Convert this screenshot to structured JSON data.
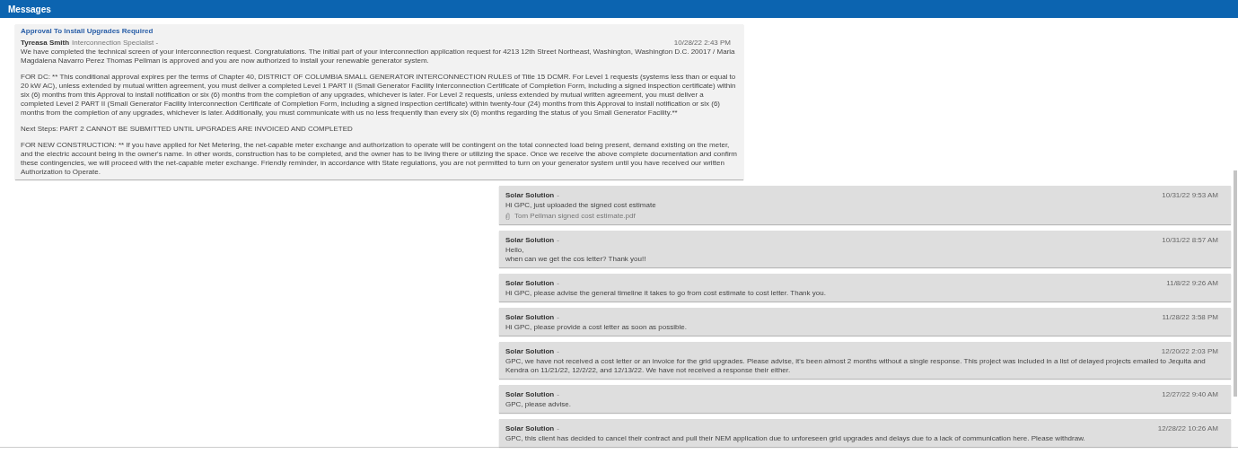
{
  "header": {
    "title": "Messages"
  },
  "messages": [
    {
      "kind": "notice",
      "subject": "Approval To Install Upgrades Required",
      "sender": "Tyreasa Smith",
      "role": "Interconnection Specialist -",
      "time": "10/28/22 2:43 PM",
      "paragraphs": [
        "We have completed the technical screen of your interconnection request. Congratulations. The initial part of your interconnection application request for 4213 12th Street Northeast, Washington, Washington D.C. 20017 / Maria Magdalena Navarro Perez Thomas Pellman is approved and you are now authorized to install your renewable generator system.",
        "FOR DC: ** This conditional approval expires per the terms of Chapter 40, DISTRICT OF COLUMBIA SMALL GENERATOR INTERCONNECTION RULES of Title 15 DCMR. For Level 1 requests (systems less than or equal to 20 kW AC), unless extended by mutual written agreement, you must deliver a completed Level 1 PART II (Small Generator Facility Interconnection Certificate of Completion Form, including a signed inspection certificate) within six (6) months from this Approval to install notification or six (6) months from the completion of any upgrades, whichever is later. For Level 2 requests, unless extended by mutual written agreement, you must deliver a completed Level 2 PART II (Small Generator Facility Interconnection Certificate of Completion Form, including a signed inspection certificate) within twenty-four (24) months from this Approval to install notification or six (6) months from the completion of any upgrades, whichever is later. Additionally, you must communicate with us no less frequently than every six (6) months regarding the status of you Small Generator Facility.**",
        "Next Steps: PART 2 CANNOT BE SUBMITTED UNTIL UPGRADES ARE INVOICED AND COMPLETED",
        "FOR NEW CONSTRUCTION: ** If you have applied for Net Metering, the net-capable meter exchange and authorization to operate will be contingent on the total connected load being present, demand existing on the meter, and the electric account being in the owner's name. In other words, construction has to be completed, and the owner has to be living there or utilizing the space. Once we receive the above complete documentation and confirm these contingencies, we will proceed with the net-capable meter exchange. Friendly reminder, in accordance with State regulations, you are not permitted to turn on your generator system until you have received our written Authorization to Operate."
      ]
    },
    {
      "kind": "reply",
      "sender": "Solar Solution",
      "role": "-",
      "time": "10/31/22 9:53 AM",
      "paragraphs": [
        "Hi GPC, just uploaded the signed cost estimate"
      ],
      "attachment": "Tom Pellman signed cost estimate.pdf"
    },
    {
      "kind": "reply",
      "sender": "Solar Solution",
      "role": "-",
      "time": "10/31/22 8:57 AM",
      "paragraphs": [
        "Hello,",
        "when can we get the cos letter? Thank you!!"
      ]
    },
    {
      "kind": "reply",
      "sender": "Solar Solution",
      "role": "-",
      "time": "11/8/22 9:26 AM",
      "paragraphs": [
        "Hi GPC, please advise the general timeline it takes to go from cost estimate to cost letter. Thank you."
      ]
    },
    {
      "kind": "reply",
      "sender": "Solar Solution",
      "role": "-",
      "time": "11/28/22 3:58 PM",
      "paragraphs": [
        "Hi GPC, please provide a cost letter as soon as possible."
      ]
    },
    {
      "kind": "reply",
      "sender": "Solar Solution",
      "role": "-",
      "time": "12/20/22 2:03 PM",
      "paragraphs": [
        "GPC, we have not received a cost letter or an invoice for the grid upgrades. Please advise, it's been almost 2 months without a single response. This project was included in a list of delayed projects emailed to Jequita and Kendra on 11/21/22, 12/2/22, and 12/13/22. We have not received a response their either."
      ]
    },
    {
      "kind": "reply",
      "sender": "Solar Solution",
      "role": "-",
      "time": "12/27/22 9:40 AM",
      "paragraphs": [
        "GPC, please advise."
      ]
    },
    {
      "kind": "reply",
      "sender": "Solar Solution",
      "role": "-",
      "time": "12/28/22 10:26 AM",
      "paragraphs": [
        "GPC, this client has decided to cancel their contract and pull their NEM application due to unforeseen grid upgrades and delays due to a lack of communication here. Please withdraw."
      ]
    }
  ]
}
